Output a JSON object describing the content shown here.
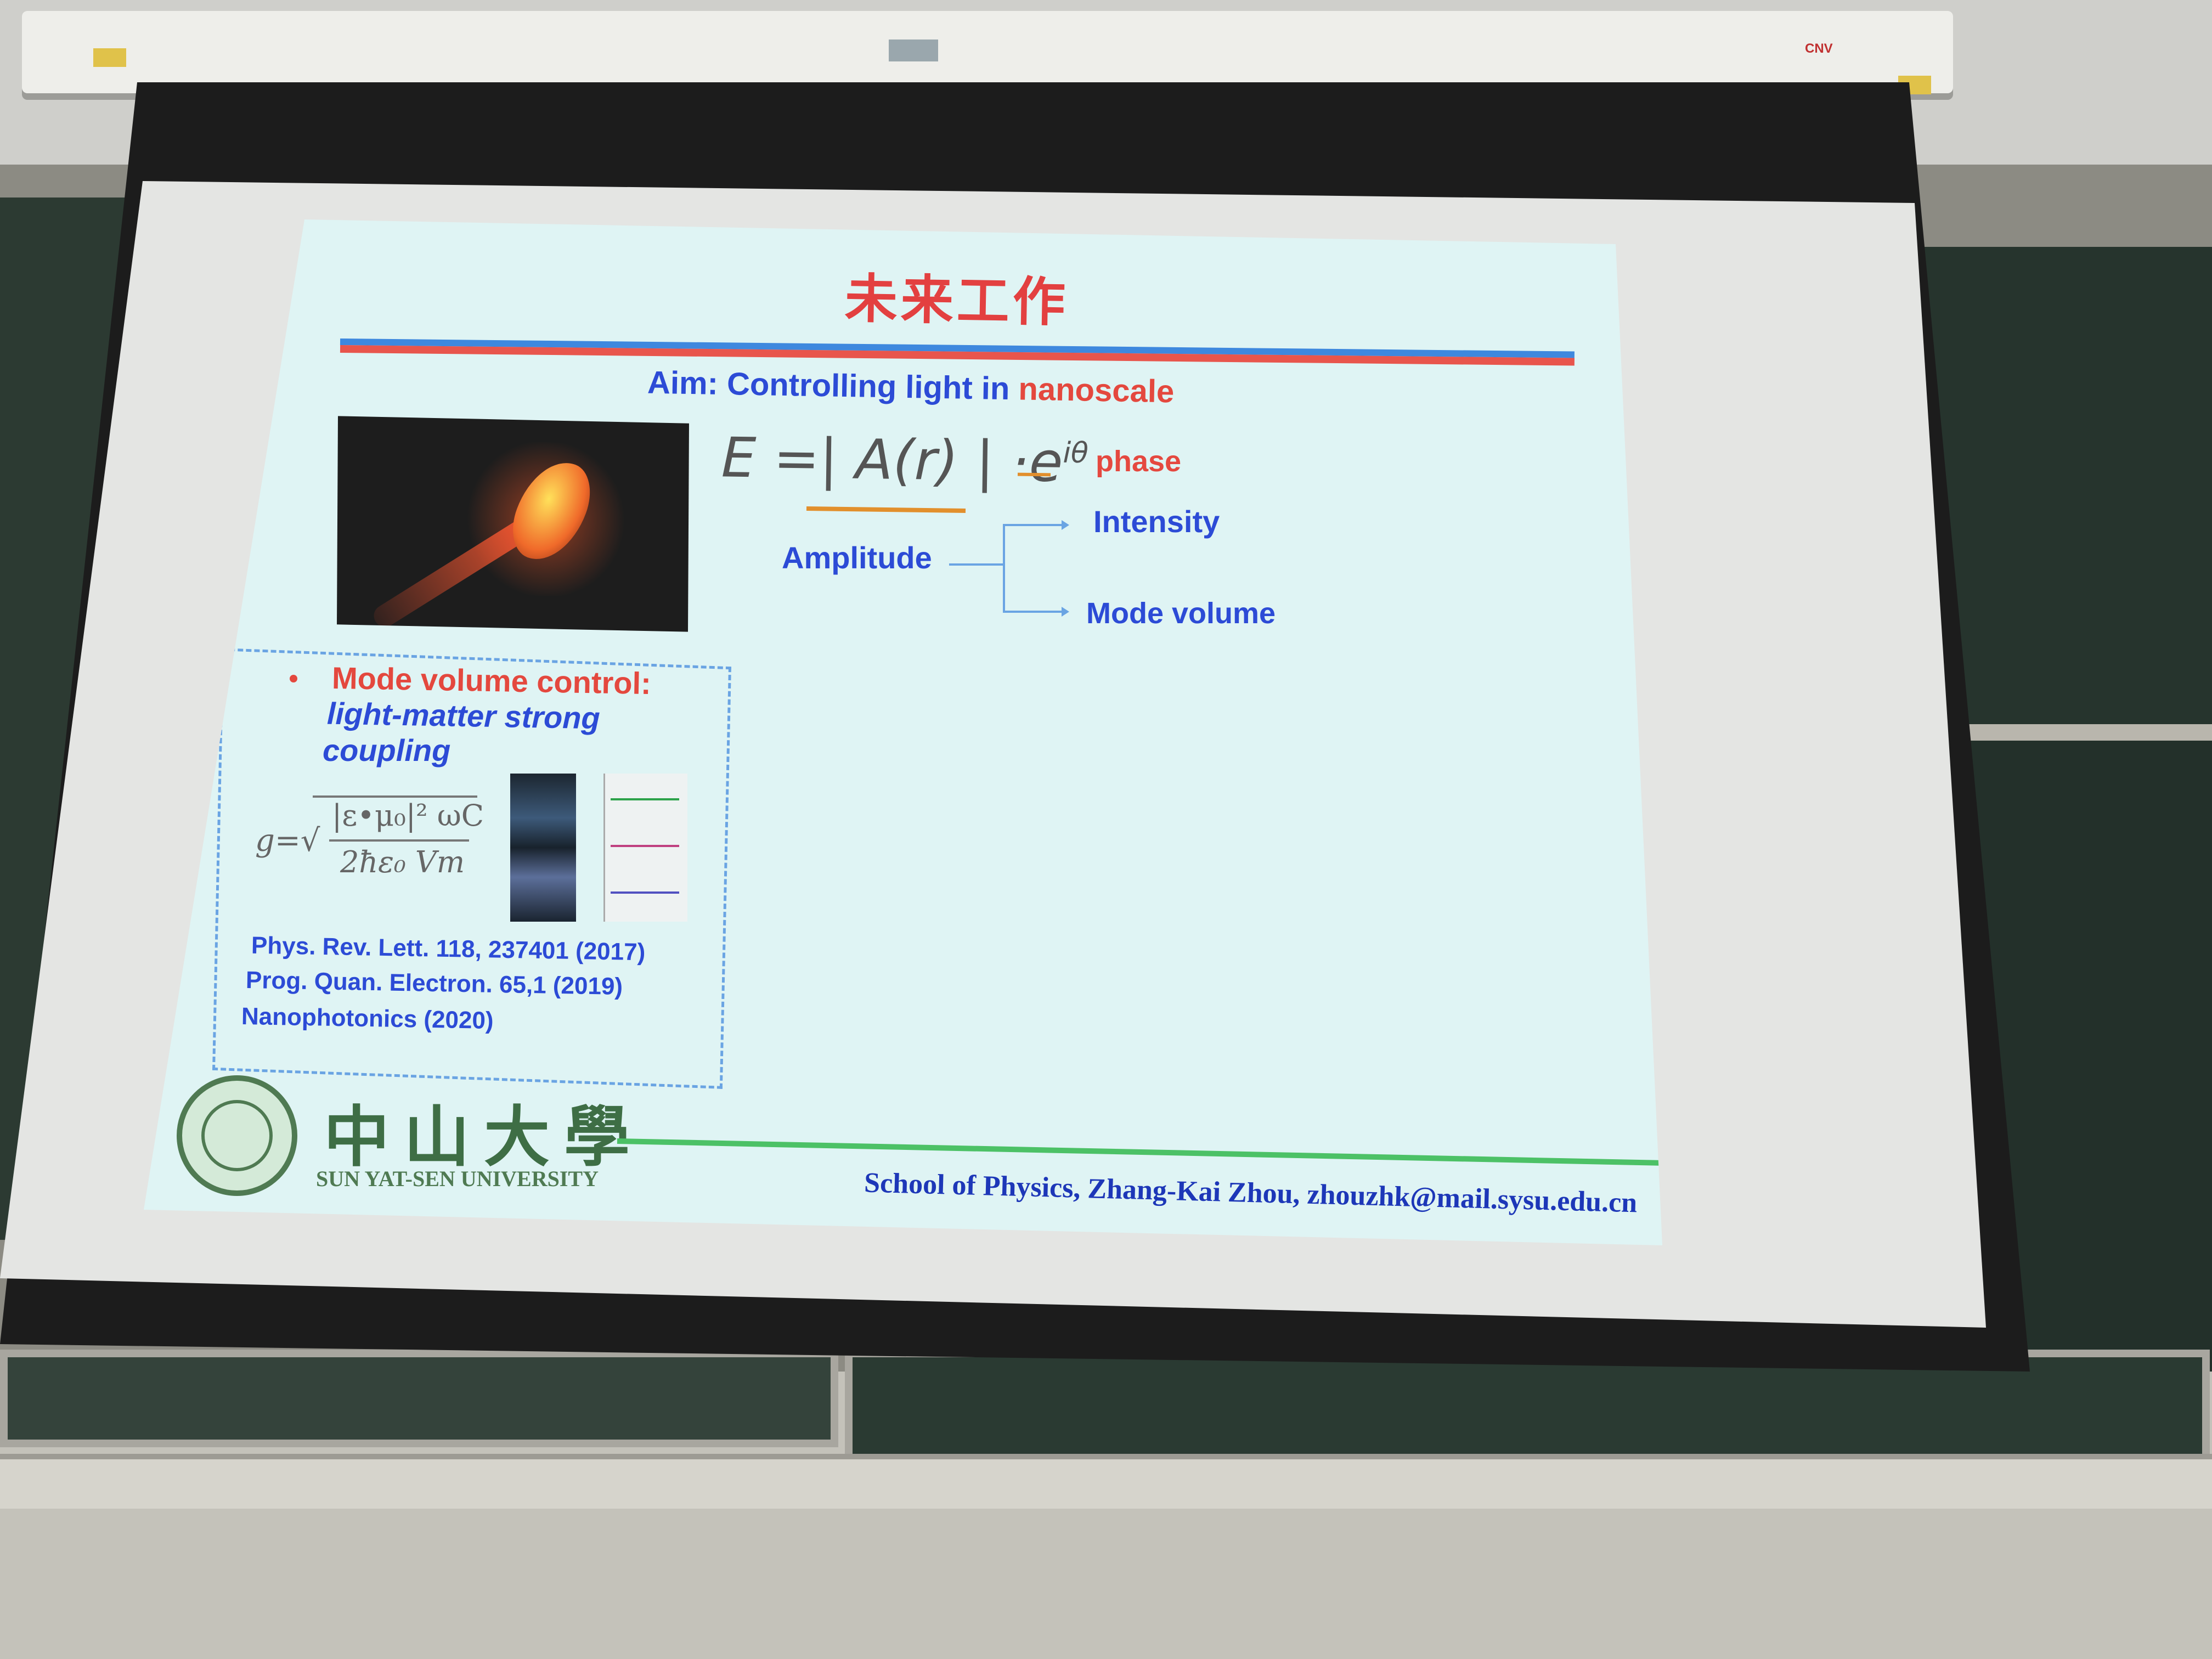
{
  "projector": {
    "brand_label": "CNV"
  },
  "slide": {
    "title": "未来工作",
    "aim_label": "Aim:  Controlling light in ",
    "aim_highlight": "nanoscale",
    "equation": {
      "lhs": "E =| A(r) | ·e",
      "exponent": "iθ"
    },
    "phase_label": "phase",
    "amplitude_label": "Amplitude",
    "intensity_label": "Intensity",
    "mode_volume_label": "Mode volume",
    "box": {
      "bullet_title": "Mode volume control:",
      "subtitle_line1": "light-matter strong",
      "subtitle_line2": "coupling",
      "formula": {
        "lhs": "g=",
        "numerator": "|ε•μ₀|² ωC",
        "denominator": "2ħε₀ Vm"
      },
      "references": [
        "Phys. Rev. Lett. 118, 237401 (2017)",
        "Prog. Quan. Electron. 65,1 (2019)",
        "Nanophotonics (2020)"
      ]
    },
    "footer": {
      "university_cn": "中山大學",
      "university_en": "SUN  YAT-SEN UNIVERSITY",
      "credit": "School of Physics, Zhang-Kai Zhou, zhouzhk@mail.sysu.edu.cn"
    }
  },
  "colors": {
    "title_red": "#e34040",
    "text_blue": "#2c4bd6",
    "rule_blue": "#3e88de",
    "rule_red": "#e8554c",
    "green_line": "#4cc166",
    "slide_bg": "#dff4f4"
  }
}
